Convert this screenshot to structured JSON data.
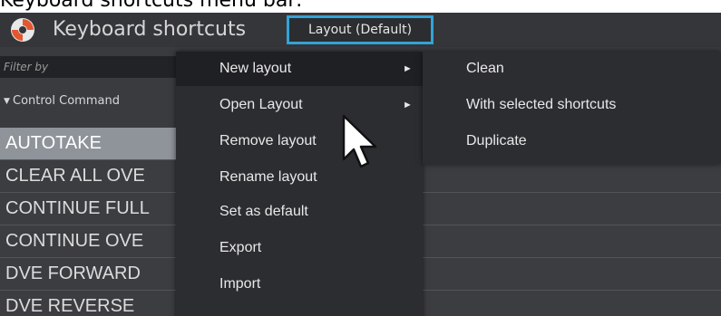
{
  "caption": "Keyboard shortcuts menu bar:",
  "app": {
    "title": "Keyboard shortcuts",
    "layout_button": "Layout (Default)",
    "logo_icon": "app-logo-icon"
  },
  "filter": {
    "placeholder": "Filter by"
  },
  "category": {
    "label": "Control Command",
    "caret_icon": "triangle-down-icon"
  },
  "rows": [
    {
      "name": "AUTOTAKE"
    },
    {
      "name": "CLEAR ALL OVE"
    },
    {
      "name": "CONTINUE FULL"
    },
    {
      "name": "CONTINUE OVE"
    },
    {
      "name": "DVE FORWARD"
    },
    {
      "name": "DVE REVERSE"
    }
  ],
  "menu": {
    "items": [
      {
        "label": "New layout",
        "has_submenu": true
      },
      {
        "label": "Open Layout",
        "has_submenu": true
      },
      {
        "label": "Remove layout"
      },
      {
        "label": "Rename layout"
      },
      {
        "label": "Set as default"
      },
      {
        "label": "Export"
      },
      {
        "label": "Import"
      }
    ],
    "arrow_glyph": "►"
  },
  "submenu": {
    "items": [
      {
        "label": "Clean"
      },
      {
        "label": "With selected shortcuts"
      },
      {
        "label": "Duplicate"
      }
    ]
  },
  "colors": {
    "accent_border": "#33a3d6",
    "menu_bg": "#2c2d31",
    "selected_row": "#8f939a"
  }
}
